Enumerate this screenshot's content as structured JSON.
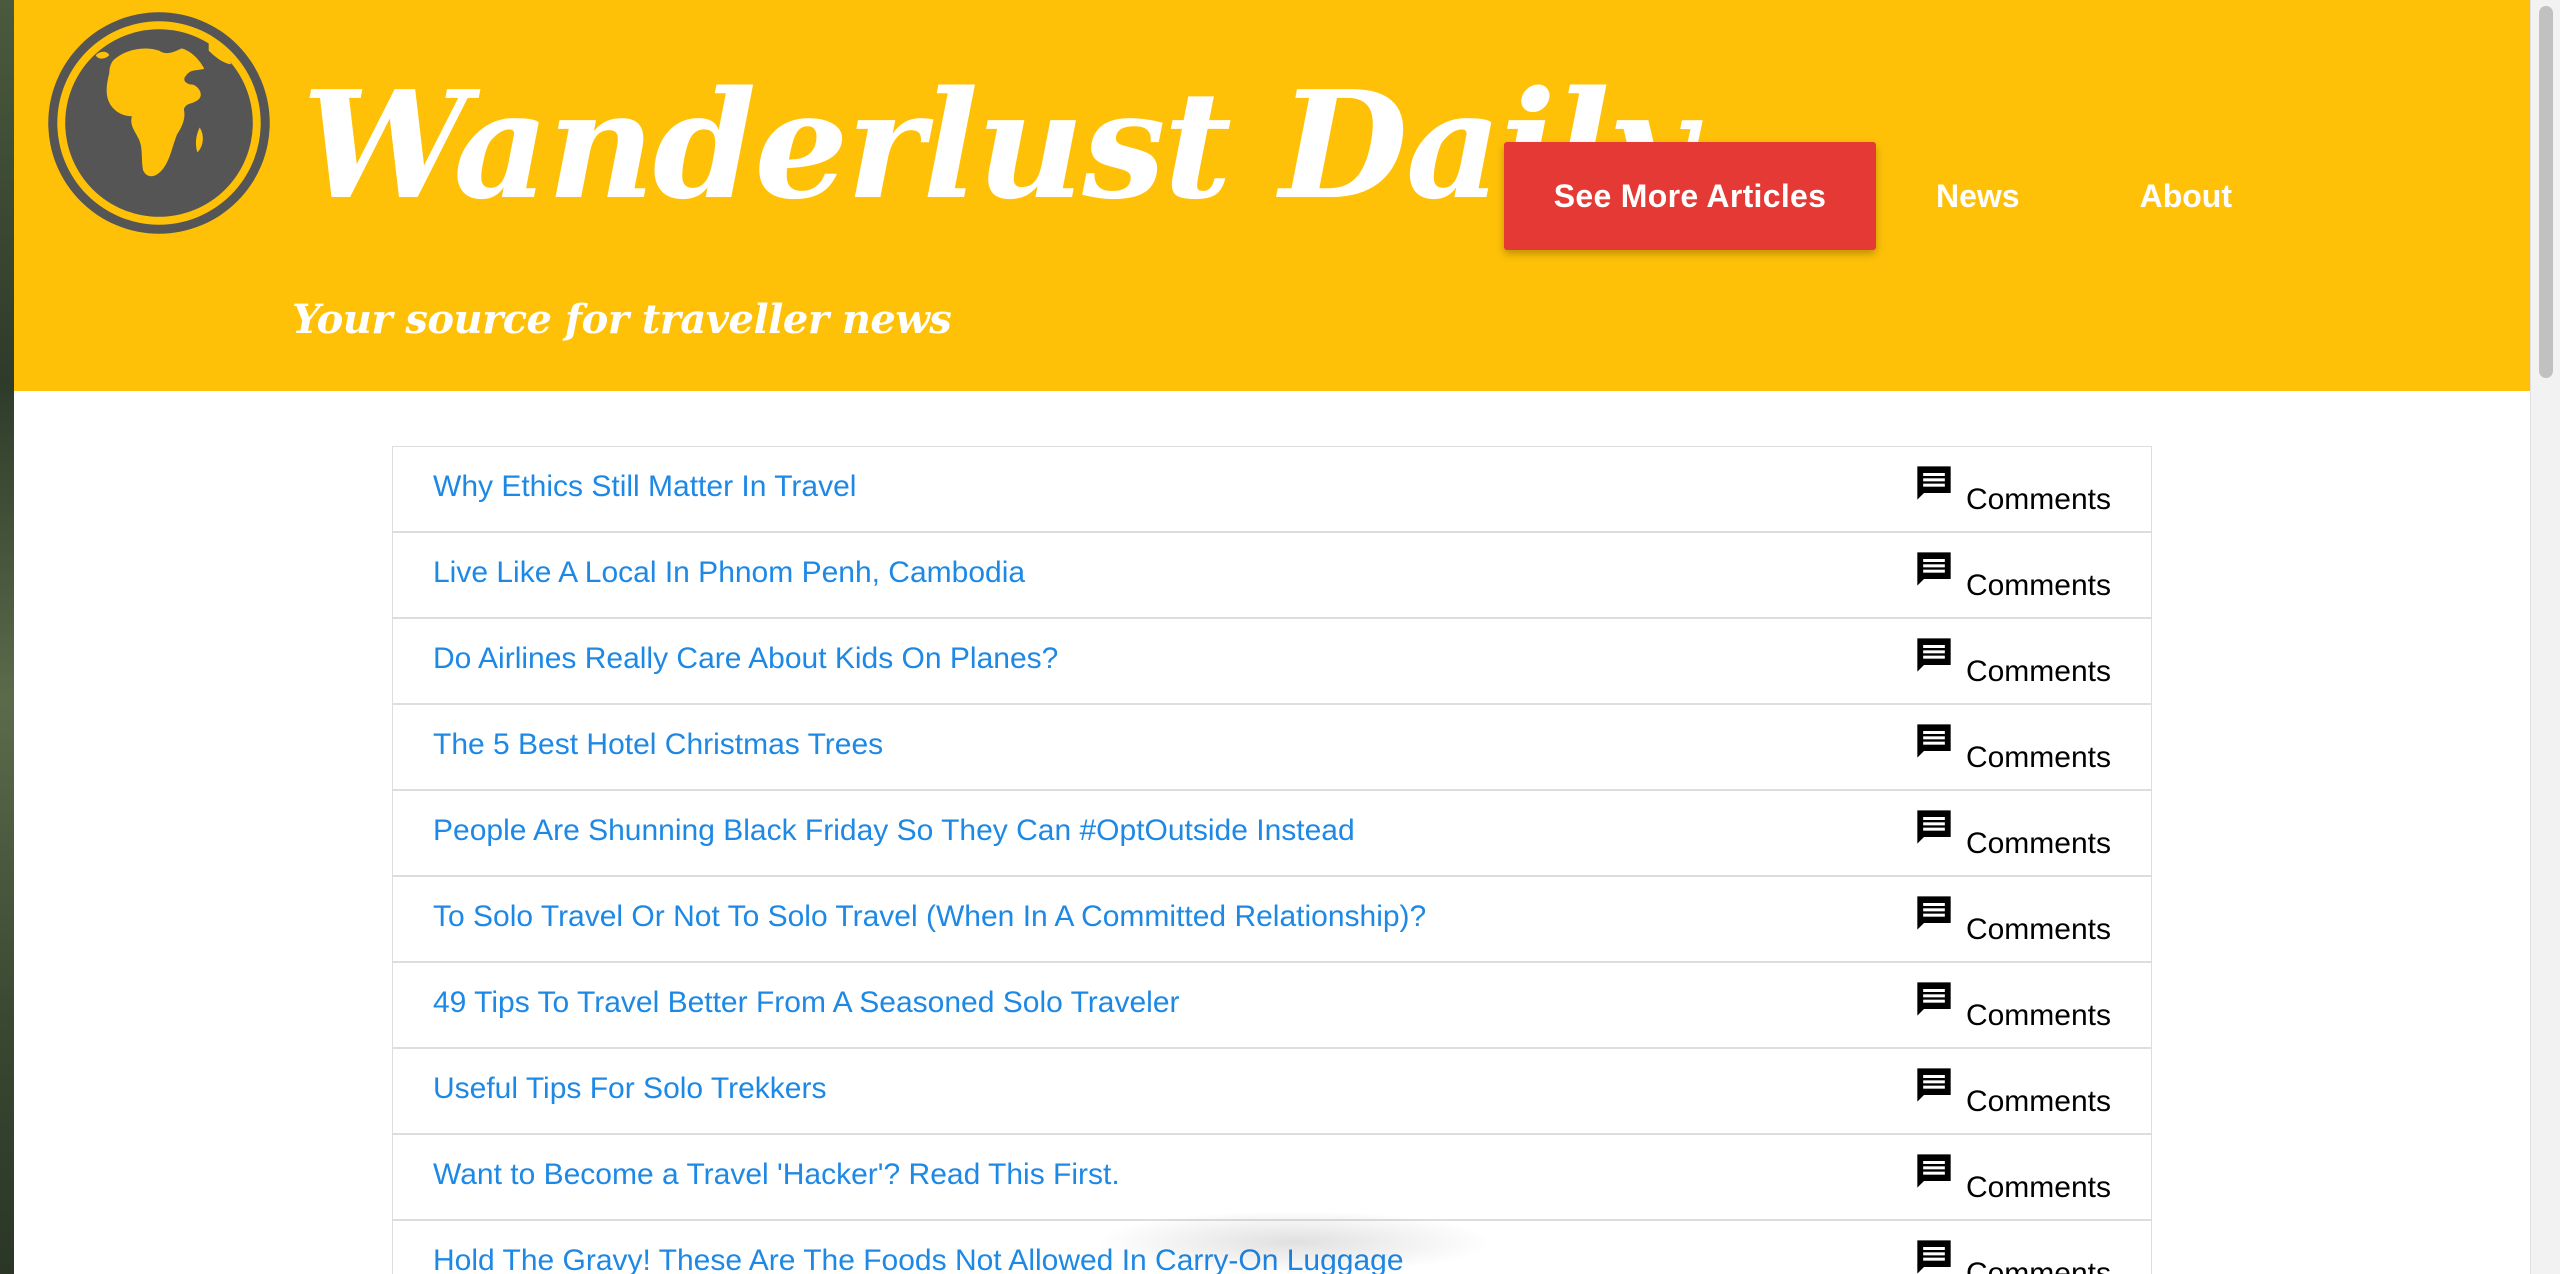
{
  "site": {
    "title": "Wanderlust Daily",
    "tagline": "Your source for traveller news",
    "logo_icon": "globe-africa-icon"
  },
  "nav": {
    "cta_label": "See More Articles",
    "news_label": "News",
    "about_label": "About"
  },
  "colors": {
    "header": "#ffc107",
    "cta": "#e53935",
    "link": "#1e88e5"
  },
  "articles": [
    {
      "title": "Why Ethics Still Matter In Travel",
      "comments_label": "Comments"
    },
    {
      "title": "Live Like A Local In Phnom Penh, Cambodia",
      "comments_label": "Comments"
    },
    {
      "title": "Do Airlines Really Care About Kids On Planes?",
      "comments_label": "Comments"
    },
    {
      "title": "The 5 Best Hotel Christmas Trees",
      "comments_label": "Comments"
    },
    {
      "title": "People Are Shunning Black Friday So They Can #OptOutside Instead",
      "comments_label": "Comments"
    },
    {
      "title": "To Solo Travel Or Not To Solo Travel (When In A Committed Relationship)?",
      "comments_label": "Comments"
    },
    {
      "title": "49 Tips To Travel Better From A Seasoned Solo Traveler",
      "comments_label": "Comments"
    },
    {
      "title": "Useful Tips For Solo Trekkers",
      "comments_label": "Comments"
    },
    {
      "title": "Want to Become a Travel 'Hacker'? Read This First.",
      "comments_label": "Comments"
    },
    {
      "title": "Hold The Gravy! These Are The Foods Not Allowed In Carry-On Luggage",
      "comments_label": "Comments"
    }
  ]
}
